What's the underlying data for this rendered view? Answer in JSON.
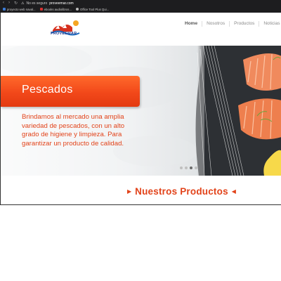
{
  "browser": {
    "security_label": "No es seguro",
    "url": "proveemar.com",
    "bookmarks": [
      {
        "label": "proyecto web naval...",
        "color": "#3b7bd6"
      },
      {
        "label": "ebooks audiolibros...",
        "color": "#d93030"
      },
      {
        "label": "Office Tool Plus Qui...",
        "color": "#bbbbbb"
      }
    ]
  },
  "site": {
    "logo_text": "PROVEEMAR",
    "menu": [
      "Home",
      "Nosotros",
      "Productos",
      "Noticias"
    ],
    "active_menu": "Home"
  },
  "hero": {
    "title": "Pescados",
    "description": "Brindamos al mercado una amplia variedad de pescados, con un alto grado de higiene y limpieza. Para garantizar un producto de calidad.",
    "slide_count": 4,
    "active_slide": 3
  },
  "products": {
    "heading": "Nuestros Productos"
  },
  "colors": {
    "accent": "#e2431a",
    "banner": "#f2481a",
    "logo_blue": "#1e3a8f"
  }
}
